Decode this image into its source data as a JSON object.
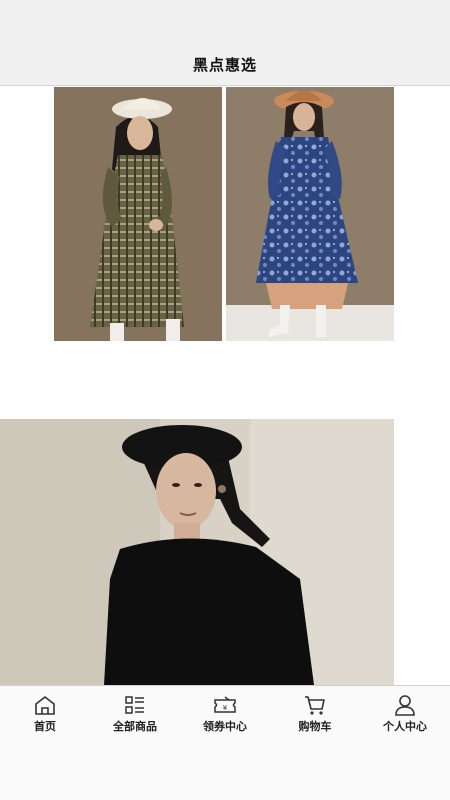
{
  "header": {
    "title": "黑点惠选"
  },
  "products": [
    {
      "name": "product-image-plaid-dress"
    },
    {
      "name": "product-image-blue-floral-dress"
    },
    {
      "name": "product-image-black-beret-outfit"
    }
  ],
  "back_to_top": {
    "icon": "chevron-up-icon"
  },
  "tabbar": {
    "items": [
      {
        "label": "首页",
        "icon": "home-icon"
      },
      {
        "label": "全部商品",
        "icon": "list-grid-icon"
      },
      {
        "label": "领券中心",
        "icon": "coupon-icon"
      },
      {
        "label": "购物车",
        "icon": "cart-icon"
      },
      {
        "label": "个人中心",
        "icon": "user-icon"
      }
    ]
  }
}
